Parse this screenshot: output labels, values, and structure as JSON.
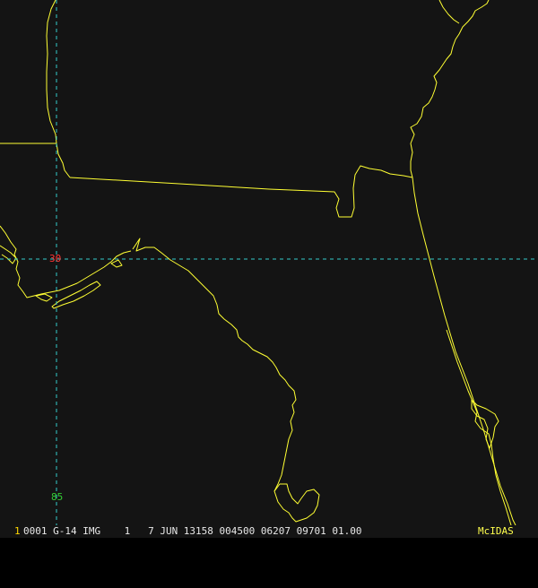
{
  "map": {
    "colors": {
      "background": "#141414",
      "coastline": "#ffff33",
      "grid": "#33cccc",
      "lat_label": "#ff3333",
      "lon_label": "#33cc33"
    },
    "grid_labels": {
      "latitude": "30",
      "longitude": "85"
    }
  },
  "status_bar": {
    "frame_number": "1",
    "info": "0001 G-14 IMG    1   7 JUN 13158 004500 06207 09701 01.00",
    "brand": "McIDAS"
  }
}
